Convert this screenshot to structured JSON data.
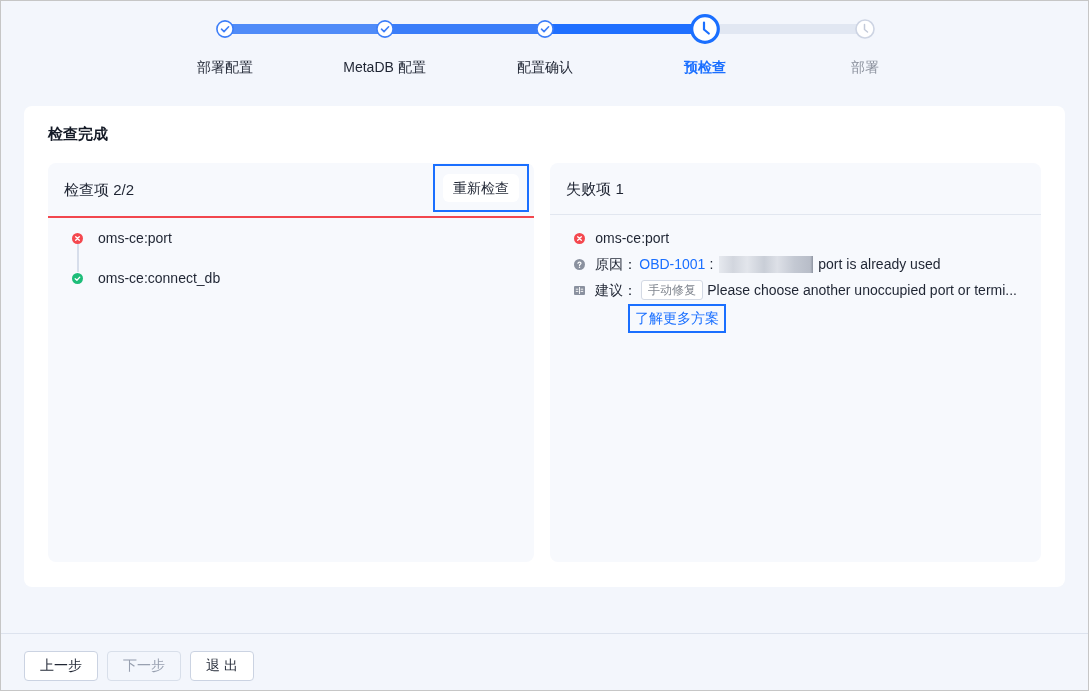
{
  "stepper": {
    "steps": [
      {
        "label": "部署配置",
        "completed": true,
        "selected": false
      },
      {
        "label": "MetaDB 配置",
        "completed": true,
        "selected": false
      },
      {
        "label": "配置确认",
        "completed": true,
        "selected": false
      },
      {
        "label": "预检查",
        "completed": false,
        "selected": true
      },
      {
        "label": "部署",
        "completed": false,
        "selected": false
      }
    ]
  },
  "result": {
    "title": "检查完成",
    "check_panel": {
      "title": "检查项 2/2",
      "failed": true,
      "recheck_button": "重新检查",
      "items": [
        {
          "name": "oms-ce:port",
          "failed": true
        },
        {
          "name": "oms-ce:connect_db",
          "failed": false
        }
      ]
    },
    "failure_panel": {
      "title": "失败项 1",
      "failure": {
        "name": "oms-ce:port",
        "failed": true
      },
      "reason_label": "原因：",
      "reason_code": "OBD-1001",
      "separator": ":",
      "reason_text": "port is already used",
      "suggestion_label": "建议：",
      "suggestion_tag": "手动修复",
      "suggestion_text": "Please choose another unoccupied port or termi...",
      "more_link": "了解更多方案"
    }
  },
  "footer": {
    "buttons": [
      {
        "label": "上一步",
        "disabled": false
      },
      {
        "label": "下一步",
        "disabled": true
      },
      {
        "label": "退 出",
        "disabled": false
      }
    ]
  }
}
